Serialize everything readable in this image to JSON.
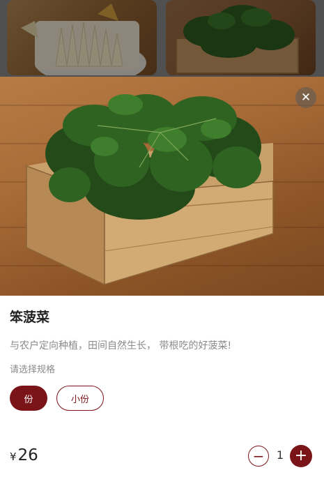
{
  "product": {
    "name": "笨菠菜",
    "description": "与农户定向种植，田间自然生长， 带根吃的好菠菜!",
    "spec_prompt": "请选择规格",
    "specs": [
      {
        "label": "份",
        "selected": true
      },
      {
        "label": "小份",
        "selected": false
      }
    ],
    "price_symbol": "¥",
    "price": "26",
    "quantity": "1"
  },
  "icons": {
    "close": "close-icon",
    "minus": "minus-icon",
    "plus": "plus-icon"
  },
  "colors": {
    "accent": "#7a1418",
    "text_primary": "#222222",
    "text_secondary": "#8a8a8a"
  }
}
